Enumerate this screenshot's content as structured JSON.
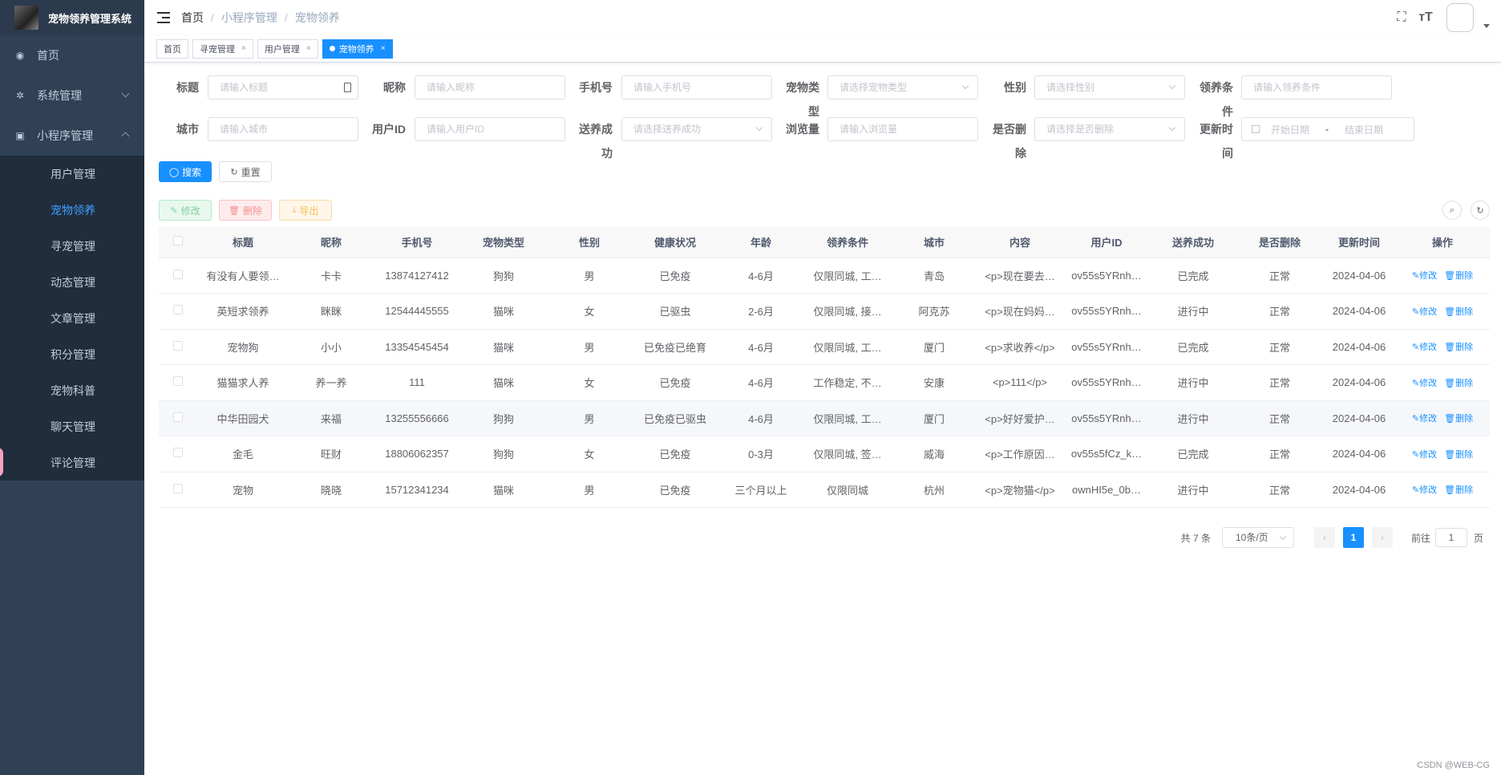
{
  "app": {
    "title": "宠物领养管理系统"
  },
  "sidebar": {
    "items": [
      {
        "label": "首页",
        "icon": "dashboard-icon"
      },
      {
        "label": "系统管理",
        "icon": "gear-icon"
      },
      {
        "label": "小程序管理",
        "icon": "app-icon"
      }
    ],
    "submenu": [
      {
        "label": "用户管理"
      },
      {
        "label": "宠物领养",
        "active": true
      },
      {
        "label": "寻宠管理"
      },
      {
        "label": "动态管理"
      },
      {
        "label": "文章管理"
      },
      {
        "label": "积分管理"
      },
      {
        "label": "宠物科普"
      },
      {
        "label": "聊天管理"
      },
      {
        "label": "评论管理"
      }
    ]
  },
  "breadcrumb": [
    "首页",
    "小程序管理",
    "宠物领养"
  ],
  "tags": [
    {
      "label": "首页",
      "closable": false
    },
    {
      "label": "寻宠管理",
      "closable": true
    },
    {
      "label": "用户管理",
      "closable": true
    },
    {
      "label": "宠物领养",
      "closable": true,
      "active": true
    }
  ],
  "search": {
    "title": {
      "label": "标题",
      "placeholder": "请输入标题"
    },
    "nickname": {
      "label": "昵称",
      "placeholder": "请输入昵称"
    },
    "phone": {
      "label": "手机号",
      "placeholder": "请输入手机号"
    },
    "pet_type": {
      "label": "宠物类型",
      "placeholder": "请选择宠物类型"
    },
    "gender": {
      "label": "性别",
      "placeholder": "请选择性别"
    },
    "condition": {
      "label": "领养条件",
      "placeholder": "请输入领养条件"
    },
    "city": {
      "label": "城市",
      "placeholder": "请输入城市"
    },
    "user_id": {
      "label": "用户ID",
      "placeholder": "请输入用户ID"
    },
    "success": {
      "label": "送养成功",
      "placeholder": "请选择送养成功"
    },
    "views": {
      "label": "浏览量",
      "placeholder": "请输入浏览量"
    },
    "deleted": {
      "label": "是否删除",
      "placeholder": "请选择是否删除"
    },
    "updated": {
      "label": "更新时间",
      "start": "开始日期",
      "sep": "-",
      "end": "结束日期"
    },
    "search_btn": "搜索",
    "reset_btn": "重置"
  },
  "toolbar": {
    "edit": "修改",
    "delete": "删除",
    "export": "导出"
  },
  "table": {
    "columns": [
      "标题",
      "昵称",
      "手机号",
      "宠物类型",
      "性别",
      "健康状况",
      "年龄",
      "领养条件",
      "城市",
      "内容",
      "用户ID",
      "送养成功",
      "是否删除",
      "更新时间",
      "操作"
    ],
    "rows": [
      [
        "有没有人要领…",
        "卡卡",
        "13874127412",
        "狗狗",
        "男",
        "已免疫",
        "4-6月",
        "仅限同城, 工…",
        "青岛",
        "<p>现在要去…",
        "ov55s5YRnh…",
        "已完成",
        "正常",
        "2024-04-06"
      ],
      [
        "英短求领养",
        "眯眯",
        "12544445555",
        "猫咪",
        "女",
        "已驱虫",
        "2-6月",
        "仅限同城, 接…",
        "阿克苏",
        "<p>现在妈妈…",
        "ov55s5YRnh…",
        "进行中",
        "正常",
        "2024-04-06"
      ],
      [
        "宠物狗",
        "小小",
        "13354545454",
        "猫咪",
        "男",
        "已免疫已绝育",
        "4-6月",
        "仅限同城, 工…",
        "厦门",
        "<p>求收养</p>",
        "ov55s5YRnh…",
        "已完成",
        "正常",
        "2024-04-06"
      ],
      [
        "猫猫求人养",
        "养一养",
        "111",
        "猫咪",
        "女",
        "已免疫",
        "4-6月",
        "工作稳定, 不…",
        "安康",
        "<p>111</p>",
        "ov55s5YRnh…",
        "进行中",
        "正常",
        "2024-04-06"
      ],
      [
        "中华田园犬",
        "来福",
        "13255556666",
        "狗狗",
        "男",
        "已免疫已驱虫",
        "4-6月",
        "仅限同城, 工…",
        "厦门",
        "<p>好好爱护…",
        "ov55s5YRnh…",
        "进行中",
        "正常",
        "2024-04-06"
      ],
      [
        "金毛",
        "旺财",
        "18806062357",
        "狗狗",
        "女",
        "已免疫",
        "0-3月",
        "仅限同城, 签…",
        "威海",
        "<p>工作原因…",
        "ov55s5fCz_k…",
        "已完成",
        "正常",
        "2024-04-06"
      ],
      [
        "宠物",
        "晓晓",
        "15712341234",
        "猫咪",
        "男",
        "已免疫",
        "三个月以上",
        "仅限同城",
        "杭州",
        "<p>宠物猫</p>",
        "ownHI5e_0b…",
        "进行中",
        "正常",
        "2024-04-06"
      ]
    ],
    "op_edit": "修改",
    "op_delete": "删除"
  },
  "pagination": {
    "total": "共 7 条",
    "page_size": "10条/页",
    "current": "1",
    "goto": "前往",
    "goto_value": "1",
    "page_suffix": "页"
  },
  "watermark": "CSDN @WEB-CG"
}
